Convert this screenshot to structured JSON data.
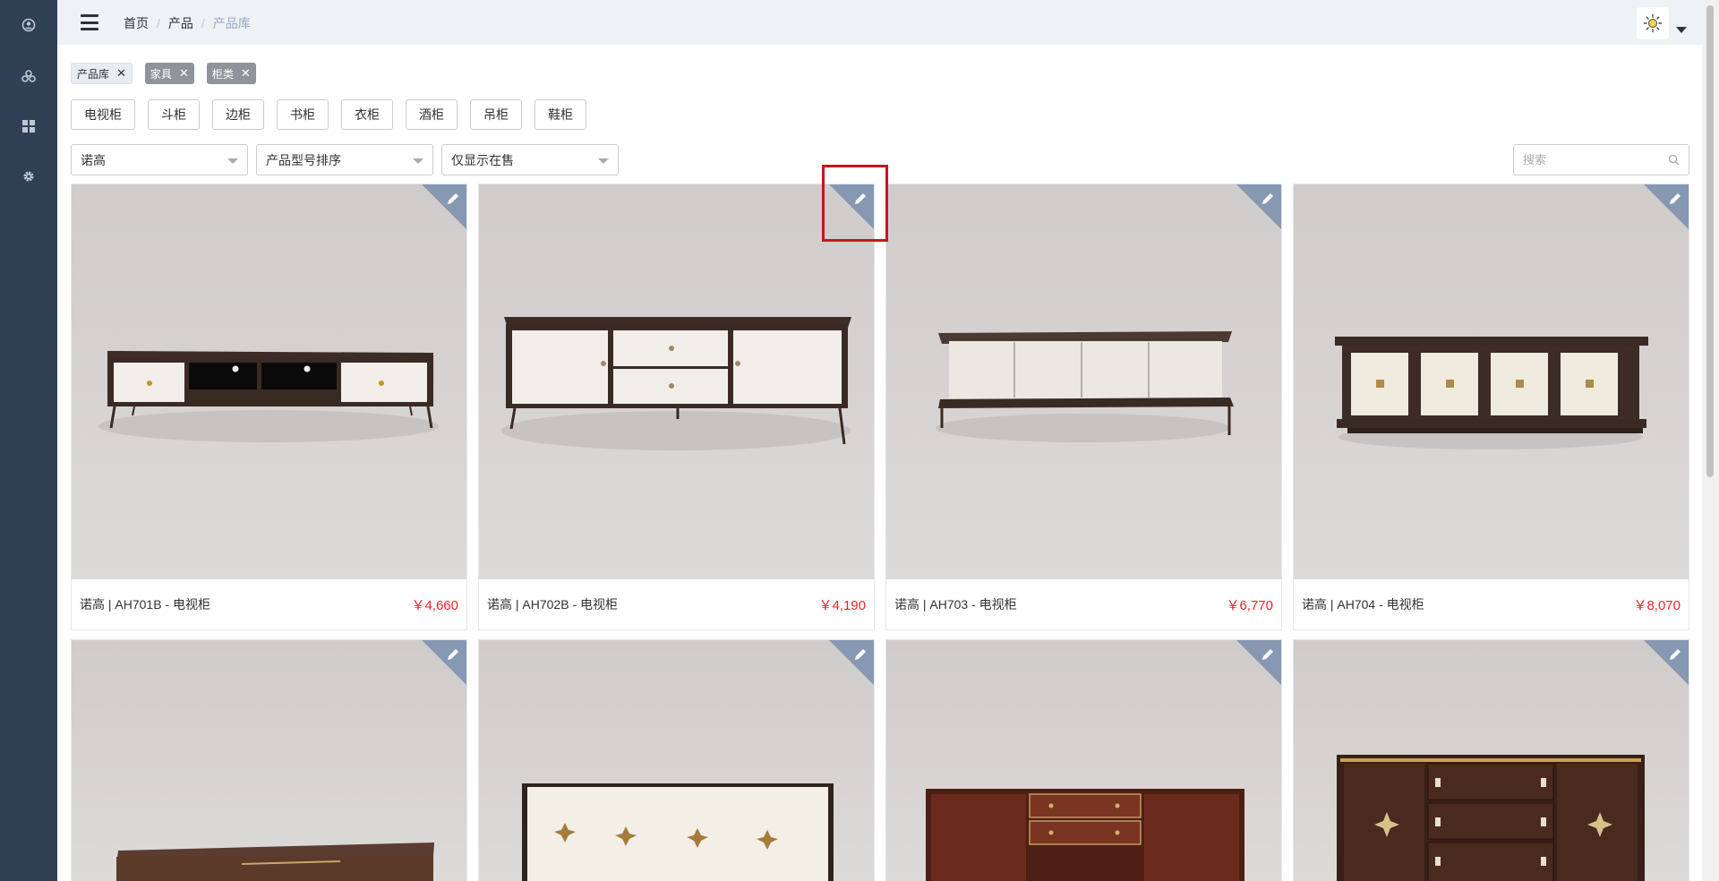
{
  "sidebar": {
    "items": [
      {
        "icon": "user-circle-icon"
      },
      {
        "icon": "cubes-icon"
      },
      {
        "icon": "grid-icon"
      },
      {
        "icon": "gear-icon"
      }
    ]
  },
  "header": {
    "breadcrumb": [
      {
        "label": "首页"
      },
      {
        "label": "产品"
      },
      {
        "label": "产品库"
      }
    ],
    "theme_icon": "sun-icon"
  },
  "tags": [
    {
      "label": "产品库",
      "close": "✕"
    },
    {
      "label": "家具",
      "close": "✕"
    },
    {
      "label": "柜类",
      "close": "✕"
    }
  ],
  "categories": [
    "电视柜",
    "斗柜",
    "边柜",
    "书柜",
    "衣柜",
    "酒柜",
    "吊柜",
    "鞋柜"
  ],
  "filters": {
    "brand": "诺高",
    "sort": "产品型号排序",
    "status": "仅显示在售",
    "search_placeholder": "搜索"
  },
  "products": [
    {
      "name": "诺高 | AH701B - 电视柜",
      "price": "￥4,660"
    },
    {
      "name": "诺高 | AH702B - 电视柜",
      "price": "￥4,190"
    },
    {
      "name": "诺高 | AH703 - 电视柜",
      "price": "￥6,770"
    },
    {
      "name": "诺高 | AH704 - 电视柜",
      "price": "￥8,070"
    },
    {
      "name": "",
      "price": ""
    },
    {
      "name": "",
      "price": ""
    },
    {
      "name": "",
      "price": ""
    },
    {
      "name": "",
      "price": ""
    }
  ],
  "colors": {
    "sidebar": "#304156",
    "header": "#eef1f6",
    "price": "#f5222d",
    "edit_corner": "#8798b2",
    "highlight": "#c8161d"
  }
}
